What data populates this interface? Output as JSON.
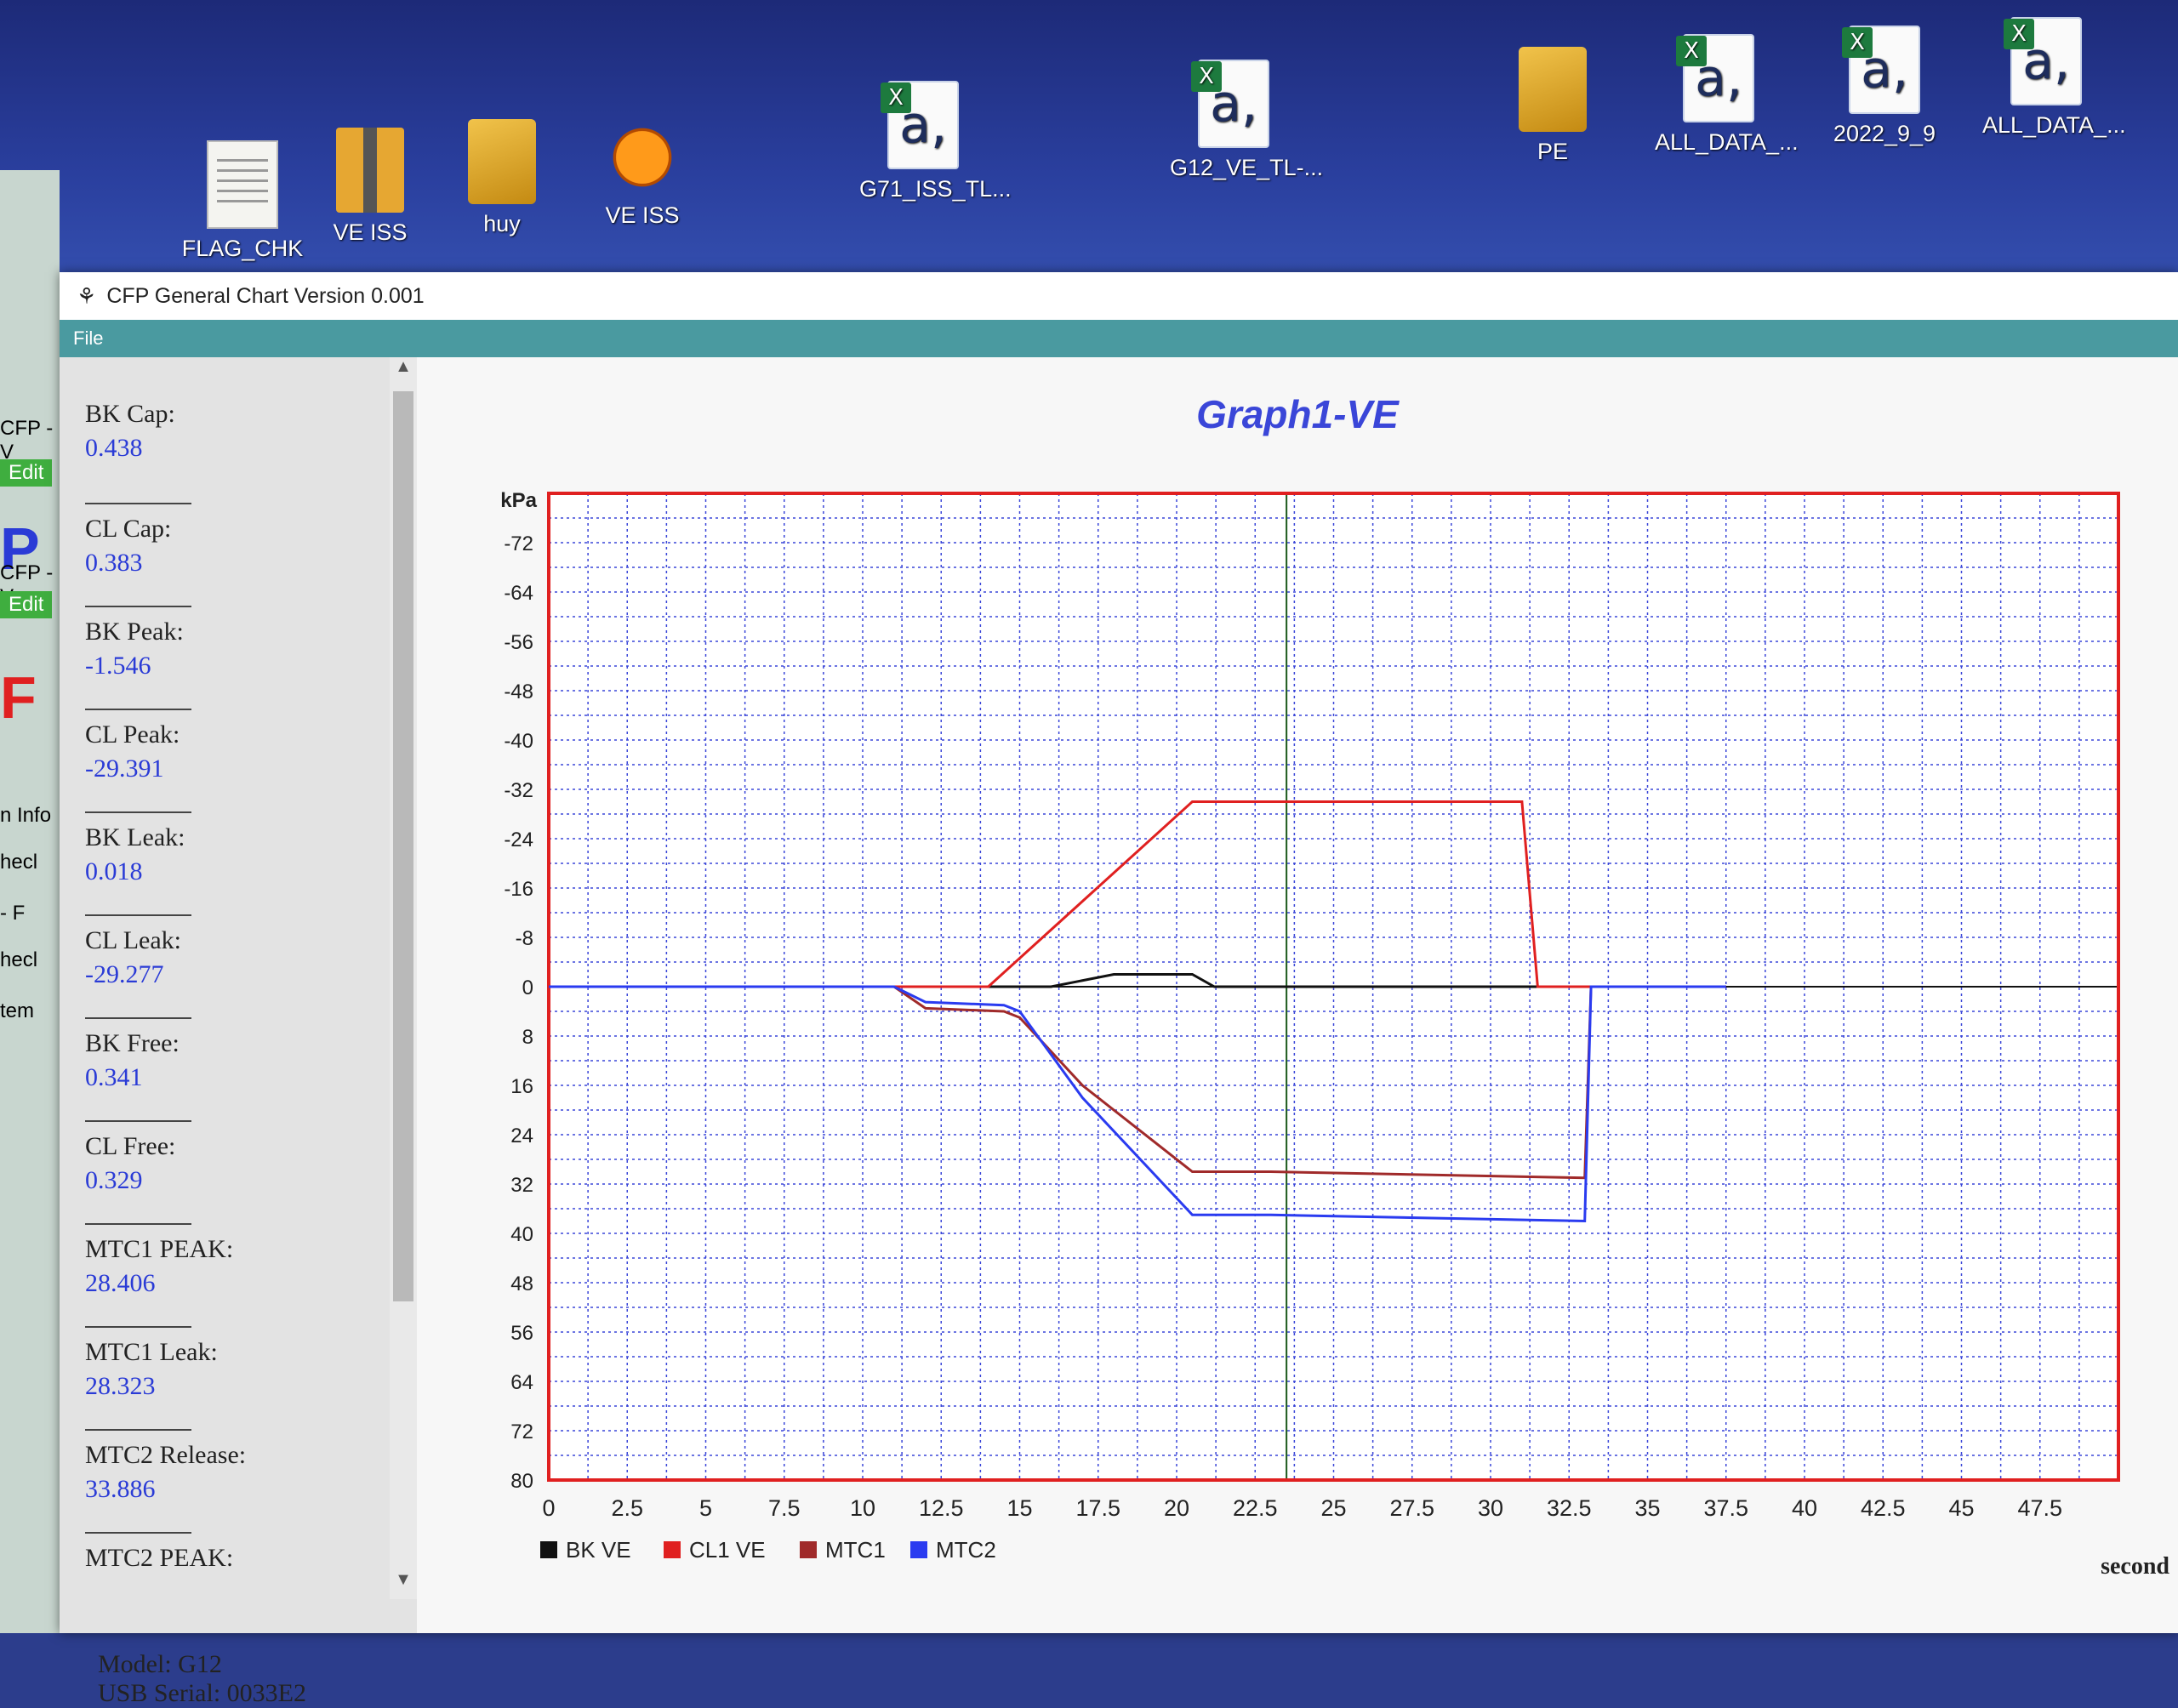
{
  "desktop": {
    "icons": [
      {
        "label": "FLAG_CHK",
        "kind": "doc"
      },
      {
        "label": "VE ISS",
        "kind": "zip"
      },
      {
        "label": "huy",
        "kind": "folder"
      },
      {
        "label": "VE ISS",
        "kind": "pumpkin"
      },
      {
        "label": "G71_ISS_TL...",
        "kind": "excel"
      },
      {
        "label": "G12_VE_TL-...",
        "kind": "excel"
      },
      {
        "label": "PE",
        "kind": "folder"
      },
      {
        "label": "ALL_DATA_...",
        "kind": "excel"
      },
      {
        "label": "2022_9_9",
        "kind": "excel"
      },
      {
        "label": "ALL_DATA_...",
        "kind": "excel"
      }
    ],
    "excel_letter": "a,"
  },
  "left_fragments": [
    "CFP - V",
    "Edit",
    "P",
    "CFP - V",
    "Edit",
    "F",
    "n Info",
    "hecl",
    "- F",
    "hecl",
    "tem"
  ],
  "window": {
    "title": "CFP General Chart Version 0.001",
    "menu": "File"
  },
  "stats": [
    {
      "label": "BK Cap:",
      "value": "0.438"
    },
    {
      "label": "CL Cap:",
      "value": "0.383"
    },
    {
      "label": "BK Peak:",
      "value": "-1.546"
    },
    {
      "label": "CL Peak:",
      "value": "-29.391"
    },
    {
      "label": "BK Leak:",
      "value": "0.018"
    },
    {
      "label": "CL Leak:",
      "value": "-29.277"
    },
    {
      "label": "BK Free:",
      "value": "0.341"
    },
    {
      "label": "CL Free:",
      "value": "0.329"
    },
    {
      "label": "MTC1 PEAK:",
      "value": "28.406"
    },
    {
      "label": "MTC1 Leak:",
      "value": "28.323"
    },
    {
      "label": "MTC2 Release:",
      "value": "33.886"
    },
    {
      "label": "MTC2 PEAK:",
      "value": ""
    }
  ],
  "model": {
    "line1": "Model:  G12",
    "line2": "USB Serial:  0033E2"
  },
  "colors": {
    "frame": "#e02020",
    "grid": "#3a46d8",
    "bk": "#111111",
    "cl1": "#e02020",
    "mtc1": "#a02a2a",
    "mtc2": "#2a3bf0"
  },
  "chart_data": {
    "type": "line",
    "title": "Graph1-VE",
    "ylabel": "kPa",
    "xlabel": "second",
    "ylim": [
      -80,
      80
    ],
    "y_inverted": true,
    "xlim": [
      0,
      50
    ],
    "yticks": [
      "-72",
      "-64",
      "-56",
      "-48",
      "-40",
      "-32",
      "-24",
      "-16",
      "-8",
      "0",
      "8",
      "16",
      "24",
      "32",
      "40",
      "48",
      "56",
      "64",
      "72",
      "80"
    ],
    "xticks": [
      "0",
      "2.5",
      "5",
      "7.5",
      "10",
      "12.5",
      "15",
      "17.5",
      "20",
      "22.5",
      "25",
      "27.5",
      "30",
      "32.5",
      "35",
      "37.5",
      "40",
      "42.5",
      "45",
      "47.5"
    ],
    "cursor_x": 23.5,
    "series": [
      {
        "name": "BK VE",
        "color": "#111111",
        "x": [
          0,
          12,
          14,
          15,
          16,
          18,
          20,
          20.5,
          21.2,
          22,
          24,
          37.5
        ],
        "y": [
          0,
          0,
          0,
          0,
          0,
          -2,
          -2,
          -2,
          0,
          0,
          0,
          0
        ]
      },
      {
        "name": "CL1 VE",
        "color": "#e02020",
        "x": [
          0,
          13,
          14,
          20.5,
          30,
          31,
          31.5,
          37.5
        ],
        "y": [
          0,
          0,
          0,
          -30,
          -30,
          -30,
          0,
          0
        ]
      },
      {
        "name": "MTC1",
        "color": "#a02a2a",
        "x": [
          0,
          10,
          11,
          12,
          14.5,
          15,
          17,
          20.5,
          23,
          33,
          33.2,
          37.5
        ],
        "y": [
          0,
          0,
          0,
          3.5,
          4,
          5,
          16,
          30,
          30,
          31,
          0,
          0
        ]
      },
      {
        "name": "MTC2",
        "color": "#2a3bf0",
        "x": [
          0,
          10,
          11,
          12,
          14.5,
          15,
          17,
          20.5,
          23,
          33,
          33.2,
          37.5
        ],
        "y": [
          0,
          0,
          0,
          2.5,
          3,
          4,
          18,
          37,
          37,
          38,
          0,
          0
        ]
      }
    ]
  }
}
